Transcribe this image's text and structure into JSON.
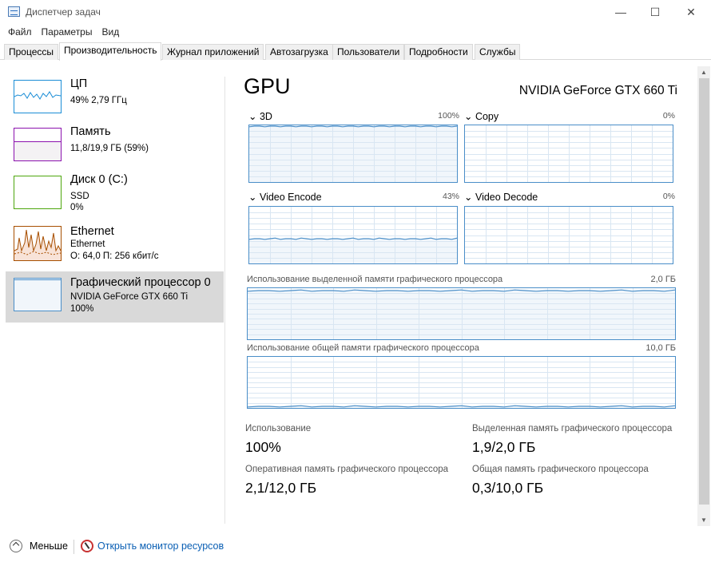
{
  "window": {
    "title": "Диспетчер задач",
    "minimize_glyph": "—",
    "maximize_glyph": "☐",
    "close_glyph": "✕"
  },
  "menu": [
    "Файл",
    "Параметры",
    "Вид"
  ],
  "tabs": [
    "Процессы",
    "Производительность",
    "Журнал приложений",
    "Автозагрузка",
    "Пользователи",
    "Подробности",
    "Службы"
  ],
  "active_tab": "Производительность",
  "sidebar": {
    "items": [
      {
        "title": "ЦП",
        "sub1": "49% 2,79 ГГц",
        "sub2": ""
      },
      {
        "title": "Память",
        "sub1": "11,8/19,9 ГБ (59%)",
        "sub2": ""
      },
      {
        "title": "Диск 0 (C:)",
        "sub1": "SSD",
        "sub2": "0%"
      },
      {
        "title": "Ethernet",
        "sub1": "Ethernet",
        "sub2": "О: 64,0 П: 256 кбит/с"
      },
      {
        "title": "Графический процессор 0",
        "sub1": "NVIDIA GeForce GTX 660 Ti",
        "sub2": "100%"
      }
    ],
    "selected_index": 4
  },
  "main": {
    "title": "GPU",
    "model": "NVIDIA GeForce GTX 660 Ti",
    "engines": [
      {
        "name": "3D",
        "percent": "100%",
        "level": 1.0
      },
      {
        "name": "Copy",
        "percent": "0%",
        "level": 0.0
      },
      {
        "name": "Video Encode",
        "percent": "43%",
        "level": 0.43
      },
      {
        "name": "Video Decode",
        "percent": "0%",
        "level": 0.0
      }
    ],
    "dedicated_memory": {
      "label": "Использование выделенной памяти графического процессора",
      "max": "2,0 ГБ",
      "level": 0.95
    },
    "shared_memory": {
      "label": "Использование общей памяти графического процессора",
      "max": "10,0 ГБ",
      "level": 0.03
    },
    "stats": {
      "usage_label": "Использование",
      "usage_value": "100%",
      "dedicated_label": "Выделенная память графического процессора",
      "dedicated_value": "1,9/2,0 ГБ",
      "gpu_ram_label": "Оперативная память графического процессора",
      "gpu_ram_value": "2,1/12,0 ГБ",
      "shared_label": "Общая память графического процессора",
      "shared_value": "0,3/10,0 ГБ"
    }
  },
  "footer": {
    "less_label": "Меньше",
    "monitor_link": "Открыть монитор ресурсов"
  },
  "colors": {
    "gpu_line": "#4a8ec8",
    "gpu_fill": "#f1f6fb",
    "cpu_line": "#1a8dd6",
    "memory_line": "#8b12ae",
    "disk_line": "#4da60c",
    "ethernet_line": "#a74f01",
    "grid": "#d9e6f2"
  }
}
